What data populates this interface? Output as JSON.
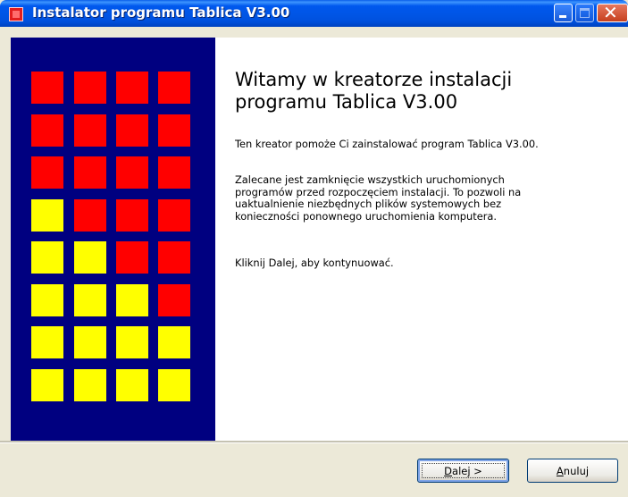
{
  "window": {
    "title": "Instalator programu Tablica V3.00",
    "controls": {
      "minimize_icon": "minimize-icon",
      "maximize_icon": "maximize-icon",
      "close_icon": "close-icon",
      "maximize_enabled": false
    }
  },
  "sidebar": {
    "background": "#000080",
    "rows": [
      [
        "red",
        "red",
        "red",
        "red"
      ],
      [
        "red",
        "red",
        "red",
        "red"
      ],
      [
        "red",
        "red",
        "red",
        "red"
      ],
      [
        "yellow",
        "red",
        "red",
        "red"
      ],
      [
        "yellow",
        "yellow",
        "red",
        "red"
      ],
      [
        "yellow",
        "yellow",
        "yellow",
        "red"
      ],
      [
        "yellow",
        "yellow",
        "yellow",
        "yellow"
      ],
      [
        "yellow",
        "yellow",
        "yellow",
        "yellow"
      ]
    ],
    "colors": {
      "red": "#FF0000",
      "yellow": "#FFFF00"
    }
  },
  "content": {
    "heading_line1": "Witamy w kreatorze instalacji",
    "heading_line2": "programu Tablica V3.00",
    "paragraph1": "Ten kreator pomoże Ci zainstalować program Tablica V3.00.",
    "paragraph2_lines": [
      "Zalecane jest zamknięcie wszystkich uruchomionych",
      "programów przed rozpoczęciem instalacji. To pozwoli na",
      "uaktualnienie niezbędnych plików systemowych bez",
      "konieczności ponownego uruchomienia komputera."
    ],
    "paragraph3": "Kliknij Dalej, aby kontynuować."
  },
  "buttons": {
    "next": {
      "mnemonic": "D",
      "rest": "alej >"
    },
    "cancel": {
      "mnemonic": "A",
      "rest": "nuluj"
    }
  }
}
